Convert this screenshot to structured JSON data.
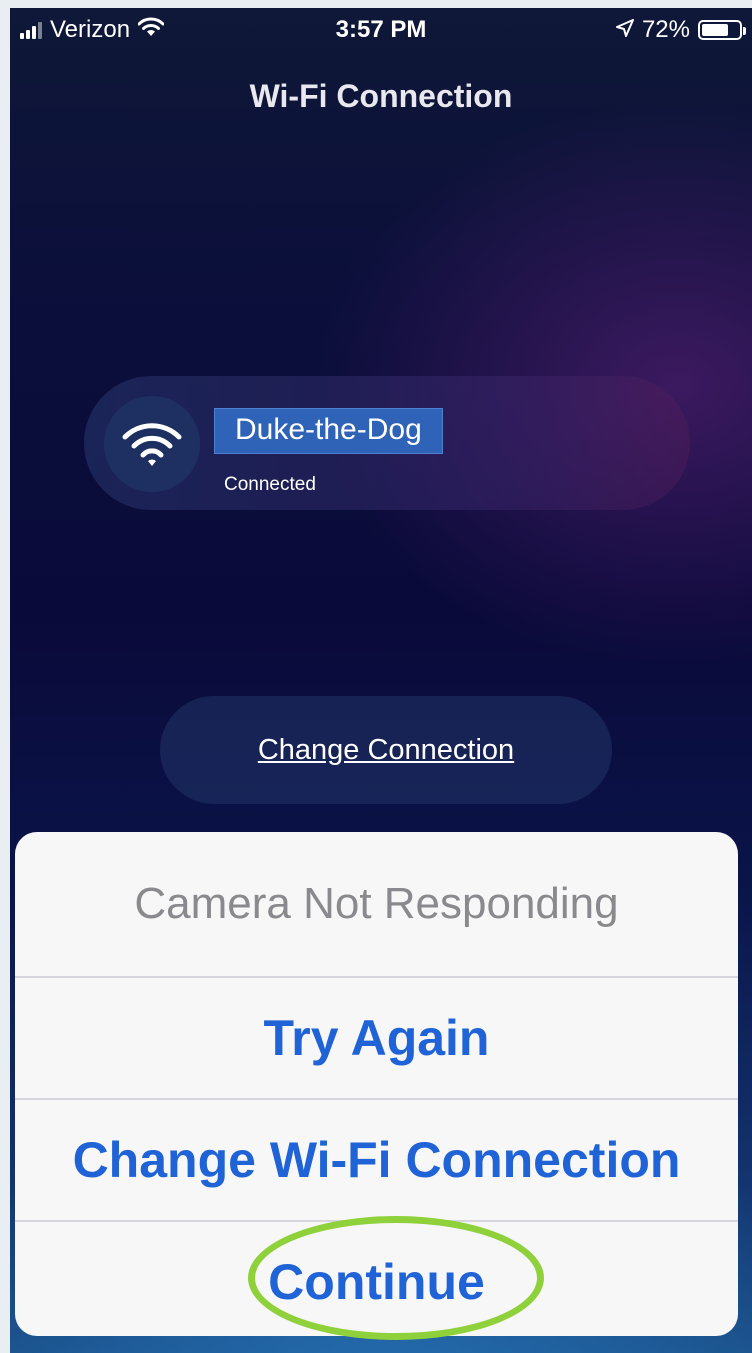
{
  "status_bar": {
    "carrier": "Verizon",
    "time": "3:57 PM",
    "battery": "72%",
    "battery_level": 0.72
  },
  "header": {
    "title": "Wi-Fi Connection"
  },
  "network": {
    "ssid": "Duke-the-Dog",
    "status": "Connected"
  },
  "change_connection": {
    "label": "Change Connection"
  },
  "alert": {
    "title": "Camera Not Responding",
    "actions": [
      {
        "label": "Try Again"
      },
      {
        "label": "Change Wi-Fi Connection"
      },
      {
        "label": "Continue"
      }
    ]
  },
  "colors": {
    "action_blue": "#1f63d6",
    "highlight_green": "#8fd13a",
    "ssid_highlight": "#2f63b8"
  }
}
